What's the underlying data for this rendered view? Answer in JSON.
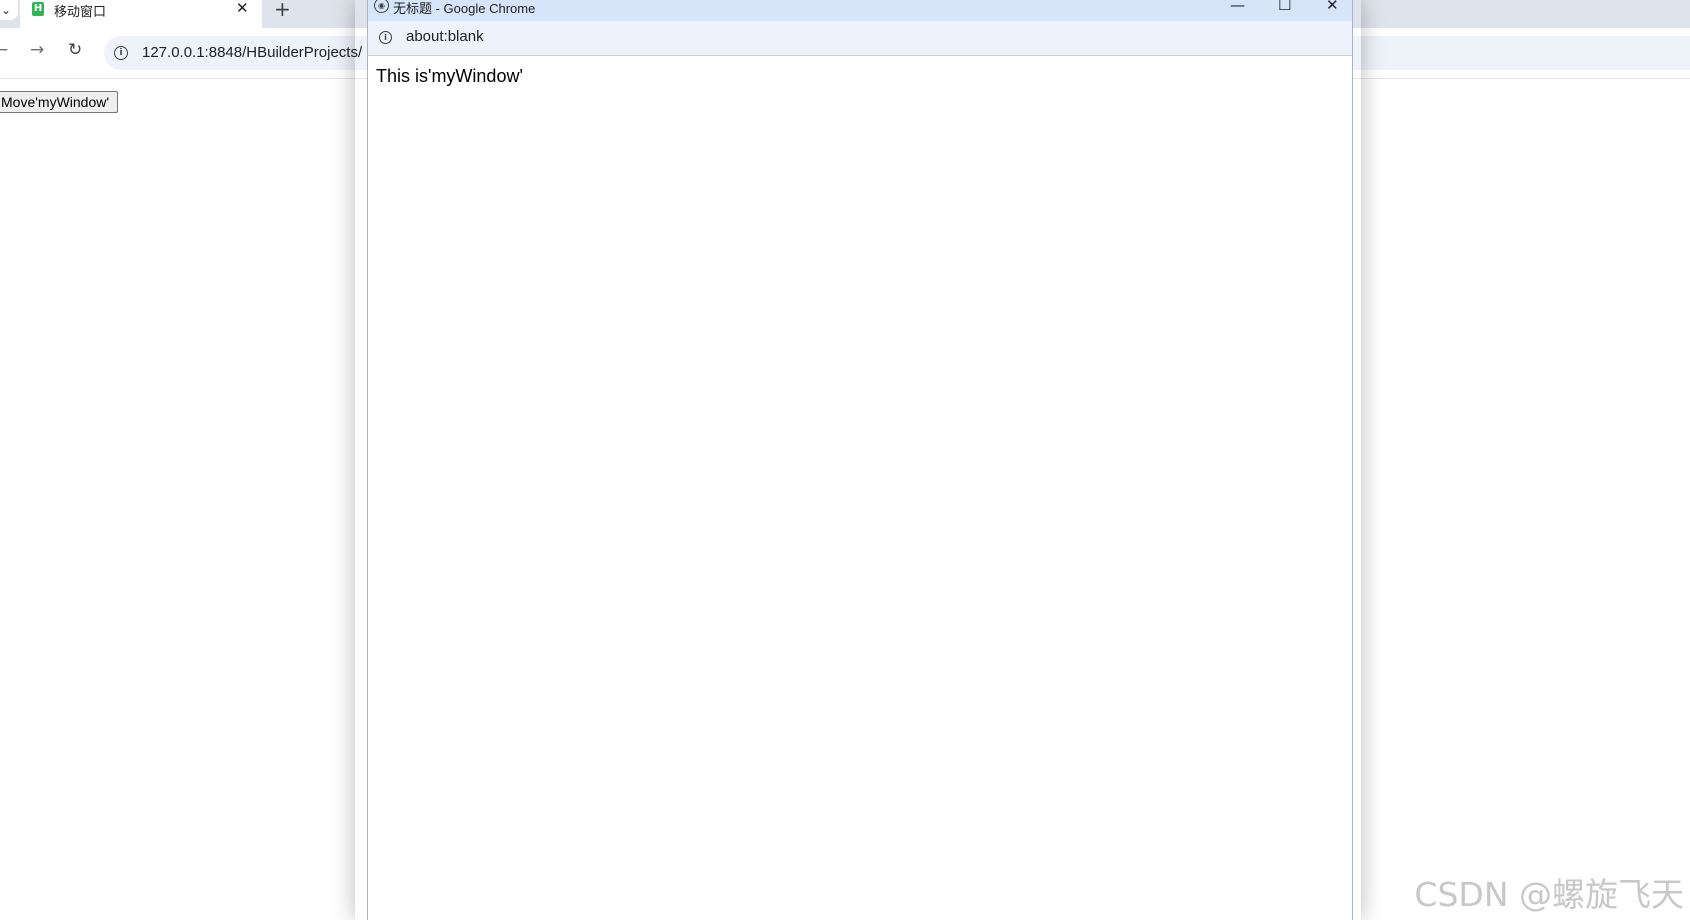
{
  "main_window": {
    "tab": {
      "favicon_letter": "H",
      "title": "移动窗口",
      "close_glyph": "✕"
    },
    "new_tab_glyph": "+",
    "nav": {
      "back_glyph": "←",
      "forward_glyph": "→",
      "reload_glyph": "↻"
    },
    "omnibox": {
      "info_glyph": "i",
      "url": "127.0.0.1:8848/HBuilderProjects/"
    },
    "page": {
      "move_button_label": "Move'myWindow'"
    }
  },
  "popup_window": {
    "title": "无标题 - Google Chrome",
    "controls": {
      "minimize_glyph": "—",
      "maximize_glyph": "☐",
      "close_glyph": "✕"
    },
    "address": {
      "info_glyph": "i",
      "url": "about:blank"
    },
    "content_text": "This is'myWindow'"
  },
  "watermark": "CSDN @螺旋飞天",
  "colors": {
    "tabstrip_bg": "#dfe3eb",
    "popup_titlebar_bg": "#d7e5fb",
    "popup_addressbar_bg": "#eef2fa",
    "favicon_green": "#2fb553"
  }
}
